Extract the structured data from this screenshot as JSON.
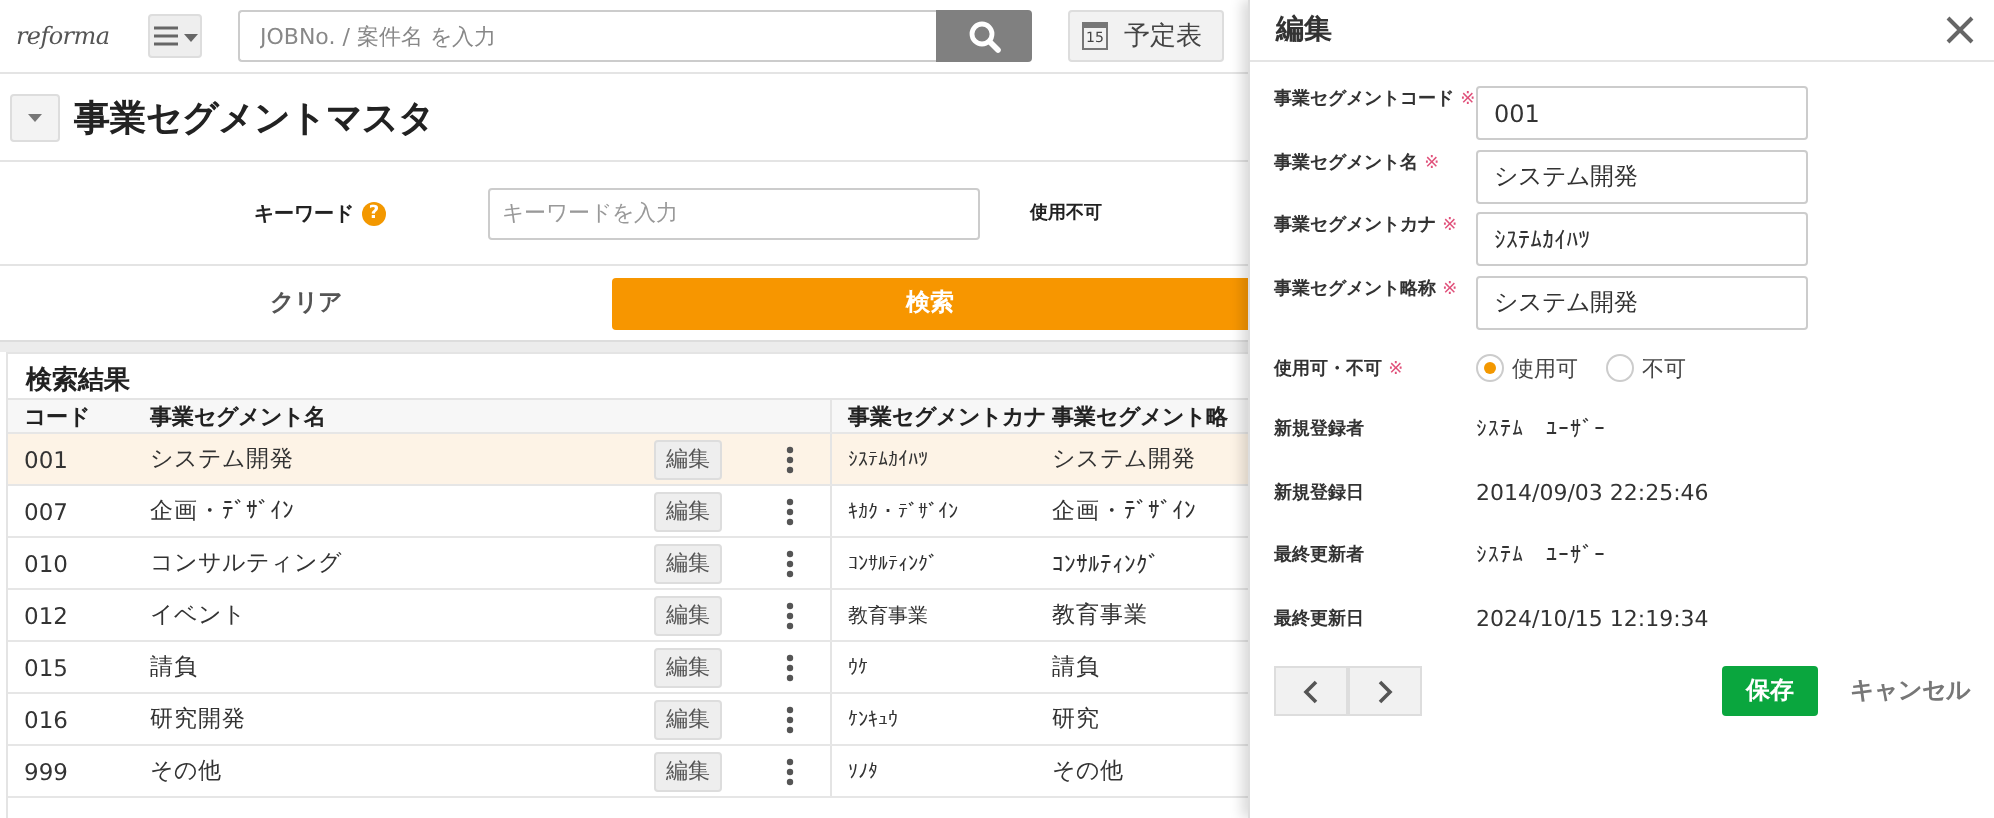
{
  "header": {
    "logo": "reforma",
    "search_placeholder": "JOBNo. / 案件名 を入力",
    "calendar_day": "15",
    "schedule_label": "予定表"
  },
  "page_title": "事業セグメントマスタ",
  "filter": {
    "keyword_label": "キーワード",
    "help_icon": "?",
    "keyword_placeholder": "キーワードを入力",
    "unusable_label": "使用不可"
  },
  "actions": {
    "clear": "クリア",
    "search": "検索"
  },
  "results": {
    "title": "検索結果",
    "columns": [
      "コード",
      "事業セグメント名",
      "事業セグメントカナ",
      "事業セグメント略"
    ],
    "rows": [
      {
        "code": "001",
        "name": "システム開発",
        "edit_label": "編集",
        "kana": "ｼｽﾃﾑｶｲﾊﾂ",
        "abbr": "システム開発",
        "selected": true
      },
      {
        "code": "007",
        "name": "企画・ﾃﾞｻﾞｲﾝ",
        "edit_label": "編集",
        "kana": "ｷｶｸ・ﾃﾞｻﾞｲﾝ",
        "abbr": "企画・ﾃﾞｻﾞｲﾝ",
        "selected": false
      },
      {
        "code": "010",
        "name": "コンサルティング",
        "edit_label": "編集",
        "kana": "ｺﾝｻﾙﾃｨﾝｸﾞ",
        "abbr": "ｺﾝｻﾙﾃｨﾝｸﾞ",
        "selected": false
      },
      {
        "code": "012",
        "name": "イベント",
        "edit_label": "編集",
        "kana": "教育事業",
        "abbr": "教育事業",
        "selected": false
      },
      {
        "code": "015",
        "name": "請負",
        "edit_label": "編集",
        "kana": "ｳｹ",
        "abbr": "請負",
        "selected": false
      },
      {
        "code": "016",
        "name": "研究開発",
        "edit_label": "編集",
        "kana": "ｹﾝｷｭｳ",
        "abbr": "研究",
        "selected": false
      },
      {
        "code": "999",
        "name": "その他",
        "edit_label": "編集",
        "kana": "ｿﾉﾀ",
        "abbr": "その他",
        "selected": false
      }
    ]
  },
  "panel": {
    "title": "編集",
    "fields": [
      {
        "label": "事業セグメントコード",
        "required_mark": "※",
        "value": "001"
      },
      {
        "label": "事業セグメント名",
        "required_mark": "※",
        "value": "システム開発"
      },
      {
        "label": "事業セグメントカナ",
        "required_mark": "※",
        "value": "ｼｽﾃﾑｶｲﾊﾂ"
      },
      {
        "label": "事業セグメント略称",
        "required_mark": "※",
        "value": "システム開発"
      }
    ],
    "usage": {
      "label": "使用可・不可",
      "required_mark": "※",
      "options": [
        {
          "label": "使用可",
          "selected": true
        },
        {
          "label": "不可",
          "selected": false
        }
      ]
    },
    "info": [
      {
        "label": "新規登録者",
        "value": "ｼｽﾃﾑ　ﾕｰｻﾞｰ"
      },
      {
        "label": "新規登録日",
        "value": "2014/09/03 22:25:46"
      },
      {
        "label": "最終更新者",
        "value": "ｼｽﾃﾑ　ﾕｰｻﾞｰ"
      },
      {
        "label": "最終更新日",
        "value": "2024/10/15 12:19:34"
      }
    ],
    "save": "保存",
    "cancel": "キャンセル"
  }
}
